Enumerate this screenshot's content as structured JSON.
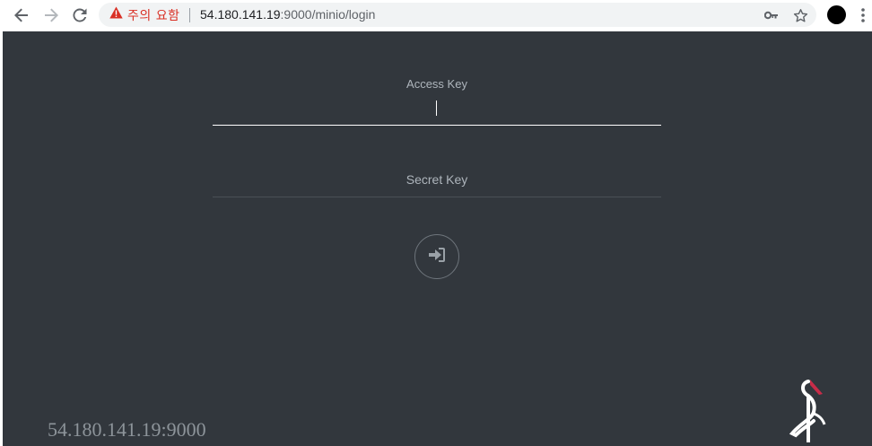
{
  "browser": {
    "security_warning": "주의 요함",
    "url_host": "54.180.141.19",
    "url_rest": ":9000/minio/login",
    "icons": {
      "back": "back-arrow-icon",
      "forward": "forward-arrow-icon",
      "reload": "reload-icon",
      "warning": "warning-triangle-icon",
      "key": "key-icon",
      "star": "star-icon",
      "profile": "profile-avatar",
      "menu": "kebab-menu-icon"
    }
  },
  "login": {
    "access_key_label": "Access Key",
    "secret_key_label": "Secret Key",
    "submit_icon": "sign-in-icon"
  },
  "footer": {
    "host": "54.180.141.19:9000"
  },
  "colors": {
    "page_bg": "#32373d",
    "warning_red": "#d93025",
    "logo_accent": "#c72c48"
  }
}
